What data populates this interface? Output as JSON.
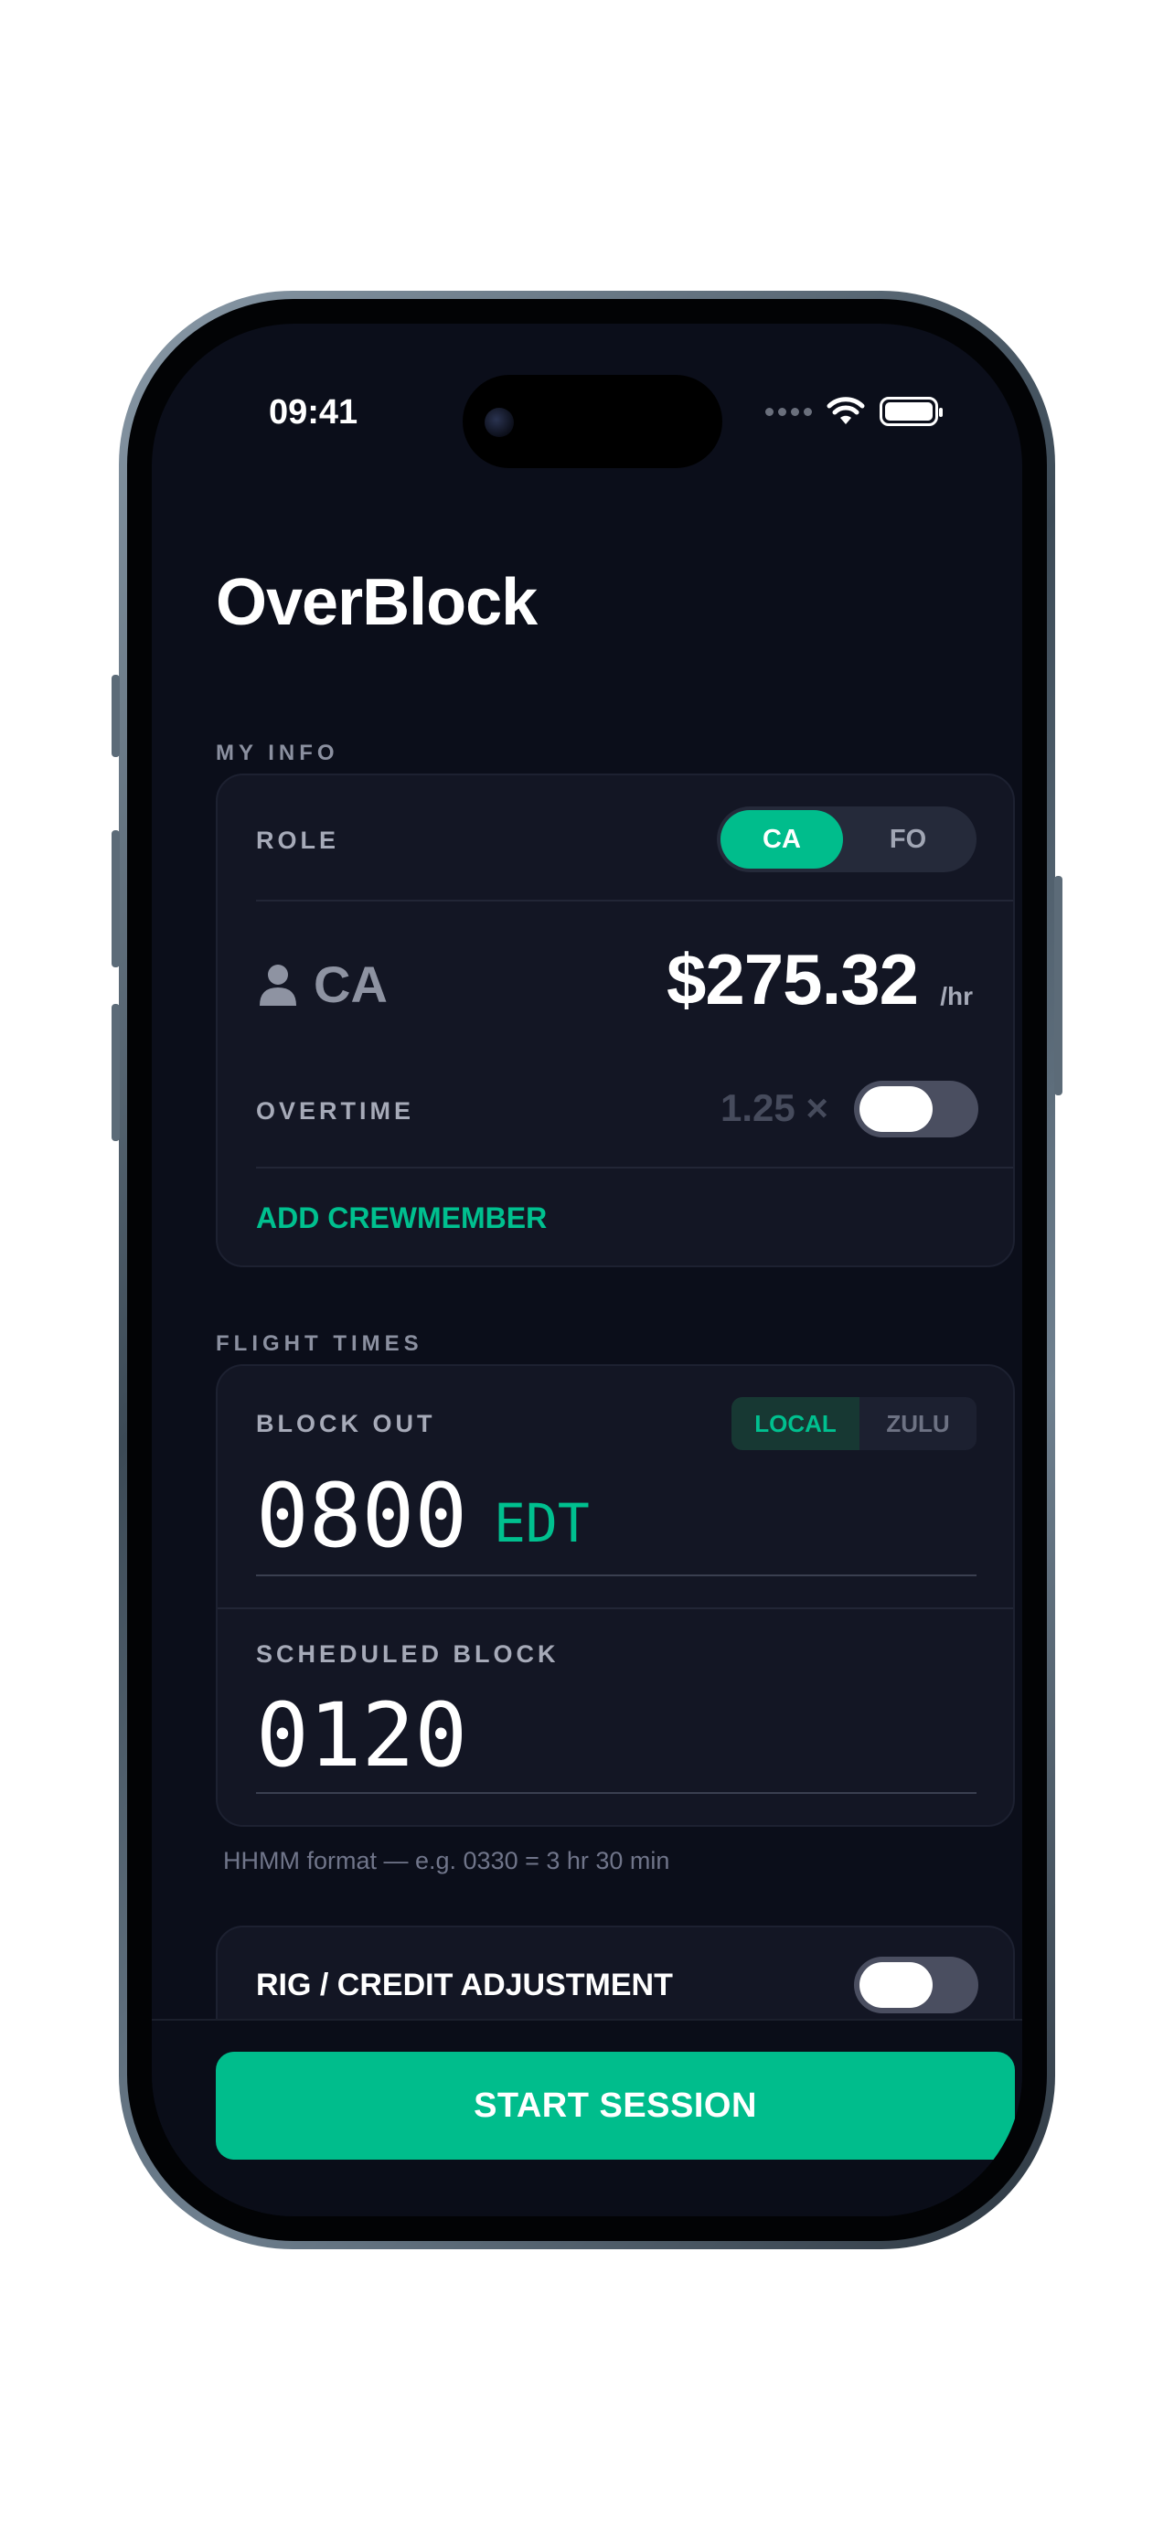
{
  "status_bar": {
    "time": "09:41"
  },
  "app": {
    "title": "OverBlock"
  },
  "my_info": {
    "section_label": "MY INFO",
    "role_label": "ROLE",
    "role_options": [
      "CA",
      "FO"
    ],
    "selected_role": "CA",
    "crew_role": "CA",
    "rate": "$275.32",
    "rate_unit": "/hr",
    "overtime_label": "OVERTIME",
    "overtime_multiplier": "1.25 ×",
    "overtime_enabled": false,
    "add_crewmember_label": "ADD CREWMEMBER"
  },
  "flight_times": {
    "section_label": "FLIGHT TIMES",
    "block_out_label": "BLOCK OUT",
    "tz_options": [
      "LOCAL",
      "ZULU"
    ],
    "selected_tz": "LOCAL",
    "block_out_value": "0800",
    "block_out_tz": "EDT",
    "scheduled_block_label": "SCHEDULED BLOCK",
    "scheduled_block_value": "0120",
    "hint": "HHMM format — e.g. 0330 = 3 hr 30 min"
  },
  "rig": {
    "label": "RIG / CREDIT ADJUSTMENT",
    "enabled": false
  },
  "actions": {
    "start_session_label": "START SESSION"
  },
  "colors": {
    "accent": "#00bd8c",
    "background": "#0b0e1a",
    "card": "#131624"
  },
  "icons": {
    "crew": "person-icon",
    "wifi": "wifi-icon",
    "battery": "battery-icon",
    "signal": "signal-dots-icon"
  }
}
